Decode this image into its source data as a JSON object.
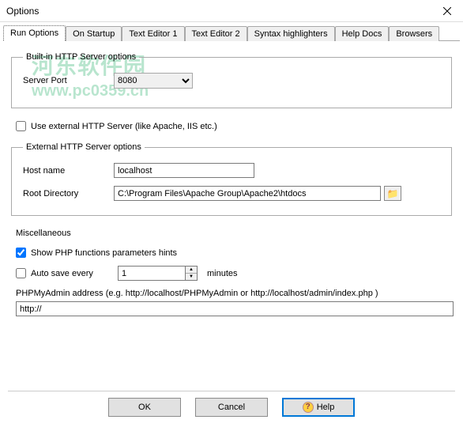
{
  "window": {
    "title": "Options"
  },
  "tabs": {
    "run_options": "Run Options",
    "on_startup": "On Startup",
    "text_editor_1": "Text Editor 1",
    "text_editor_2": "Text Editor 2",
    "syntax": "Syntax highlighters",
    "help_docs": "Help Docs",
    "browsers": "Browsers"
  },
  "builtin": {
    "legend": "Built-in HTTP Server options",
    "server_port_label": "Server Port",
    "server_port_value": "8080"
  },
  "external_chk": "Use external HTTP Server (like Apache, IIS etc.)",
  "external": {
    "legend": "External HTTP Server options",
    "host_label": "Host name",
    "host_value": "localhost",
    "root_label": "Root Directory",
    "root_value": "C:\\Program Files\\Apache Group\\Apache2\\htdocs"
  },
  "misc": {
    "title": "Miscellaneous",
    "show_hints": "Show PHP functions parameters hints",
    "auto_save": "Auto save every",
    "auto_save_value": "1",
    "minutes": "minutes",
    "phpmyadmin_label": "PHPMyAdmin address (e.g. http://localhost/PHPMyAdmin or http://localhost/admin/index.php )",
    "phpmyadmin_value": "http://"
  },
  "buttons": {
    "ok": "OK",
    "cancel": "Cancel",
    "help": "Help"
  },
  "watermark": {
    "name": "河东软件园",
    "url": "www.pc0359.cn"
  }
}
